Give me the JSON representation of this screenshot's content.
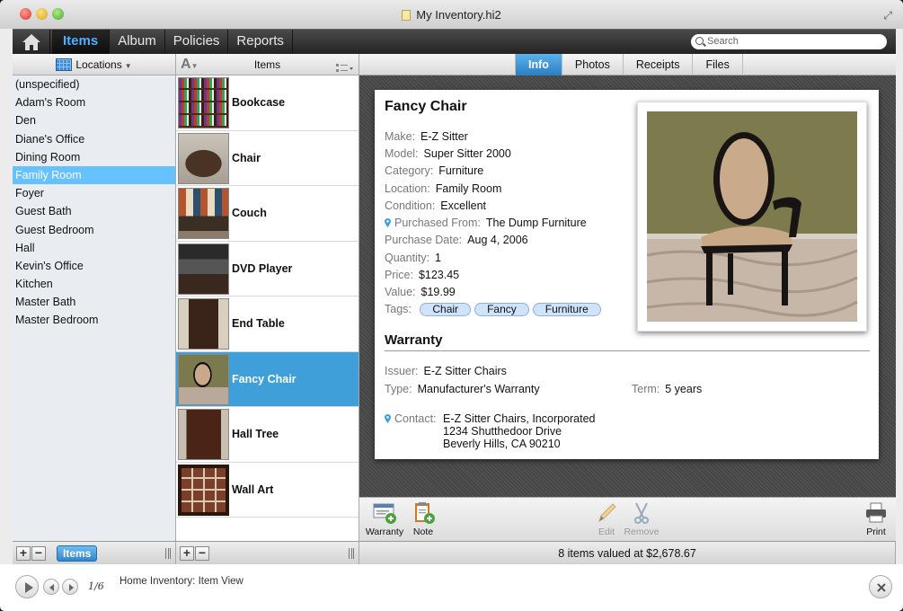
{
  "window": {
    "title": "My Inventory.hi2"
  },
  "toolbar": {
    "tabs": [
      {
        "label": "Items",
        "active": true
      },
      {
        "label": "Album",
        "active": false
      },
      {
        "label": "Policies",
        "active": false
      },
      {
        "label": "Reports",
        "active": false
      }
    ],
    "search_placeholder": "Search"
  },
  "sidebar": {
    "header_label": "Locations",
    "items": [
      "(unspecified)",
      "Adam's Room",
      "Den",
      "Diane's Office",
      "Dining Room",
      "Family Room",
      "Foyer",
      "Guest Bath",
      "Guest Bedroom",
      "Hall",
      "Kevin's Office",
      "Kitchen",
      "Master Bath",
      "Master Bedroom"
    ],
    "selected": "Family Room",
    "items_button": "Items"
  },
  "itemlist": {
    "header_label": "Items",
    "sort_icon": "A",
    "items": [
      "Bookcase",
      "Chair",
      "Couch",
      "DVD Player",
      "End Table",
      "Fancy Chair",
      "Hall Tree",
      "Wall Art"
    ],
    "selected": "Fancy Chair"
  },
  "detail": {
    "tabs": [
      {
        "label": "Info",
        "active": true
      },
      {
        "label": "Photos",
        "active": false
      },
      {
        "label": "Receipts",
        "active": false
      },
      {
        "label": "Files",
        "active": false
      }
    ],
    "title": "Fancy Chair",
    "make": {
      "label": "Make:",
      "value": "E-Z Sitter"
    },
    "model": {
      "label": "Model:",
      "value": "Super Sitter 2000"
    },
    "category": {
      "label": "Category:",
      "value": "Furniture"
    },
    "location": {
      "label": "Location:",
      "value": "Family Room"
    },
    "condition": {
      "label": "Condition:",
      "value": "Excellent"
    },
    "purchased_from": {
      "label": "Purchased From:",
      "value": "The Dump Furniture"
    },
    "purchase_date": {
      "label": "Purchase Date:",
      "value": "Aug 4, 2006"
    },
    "quantity": {
      "label": "Quantity:",
      "value": "1"
    },
    "price": {
      "label": "Price:",
      "value": "$123.45"
    },
    "value": {
      "label": "Value:",
      "value": "$19.99"
    },
    "tags_label": "Tags:",
    "tags": [
      "Chair",
      "Fancy",
      "Furniture"
    ],
    "warranty": {
      "heading": "Warranty",
      "issuer": {
        "label": "Issuer:",
        "value": "E-Z Sitter Chairs"
      },
      "type": {
        "label": "Type:",
        "value": "Manufacturer's Warranty"
      },
      "term": {
        "label": "Term:",
        "value": "5 years"
      },
      "contact_label": "Contact:",
      "contact_lines": [
        "E-Z Sitter Chairs, Incorporated",
        "1234 Shutthedoor Drive",
        "Beverly Hills, CA 90210"
      ]
    }
  },
  "actions": {
    "warranty": "Warranty",
    "note": "Note",
    "edit": "Edit",
    "remove": "Remove",
    "print": "Print"
  },
  "status": {
    "text": "8 items valued at $2,678.67"
  },
  "footer": {
    "counter": "1/6",
    "caption": "Home Inventory: Item View"
  },
  "colors": {
    "accent": "#4ab0ff",
    "selection": "#3f9fd8",
    "sidebar_selection": "#66c1ff"
  }
}
